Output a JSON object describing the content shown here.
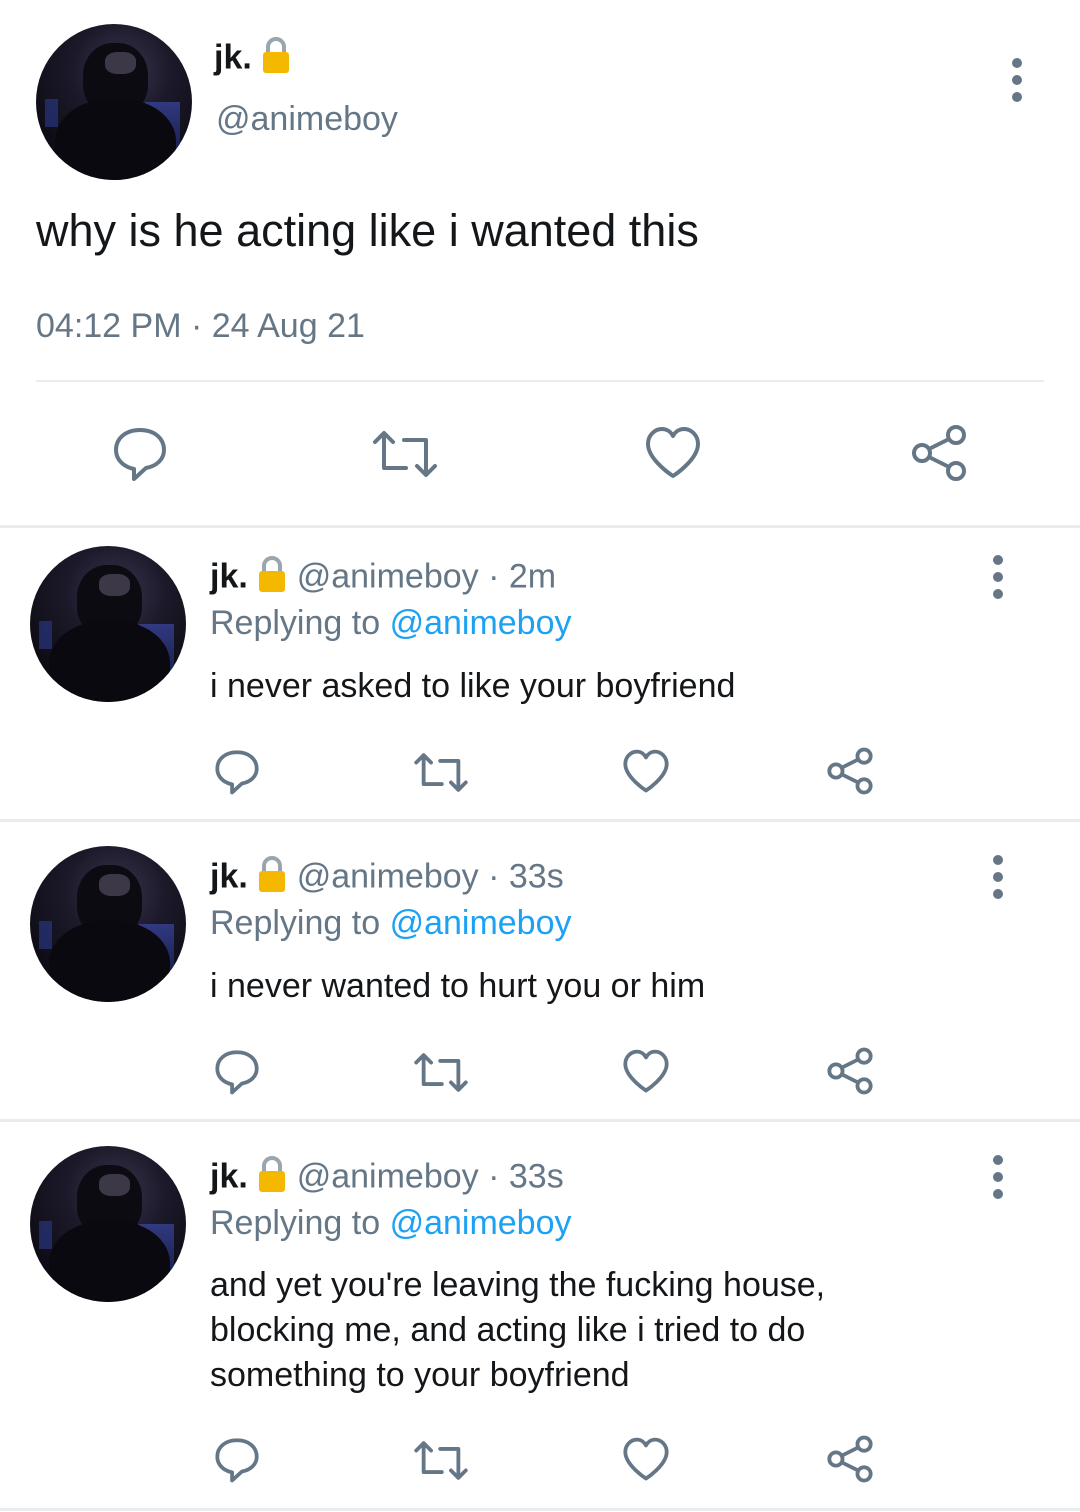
{
  "icons": {
    "more": "vertical-ellipsis-icon",
    "lock": "lock-icon",
    "reply": "reply-bubble-icon",
    "retweet": "retweet-icon",
    "like": "heart-icon",
    "share": "share-icon"
  },
  "colors": {
    "text": "#14171a",
    "muted": "#657786",
    "link": "#1da1f2",
    "lock": "#f5b800",
    "icon": "#657786"
  },
  "main_tweet": {
    "name": "jk.",
    "handle": "@animeboy",
    "text": "why is he acting like i wanted this",
    "timestamp": "04:12 PM · 24 Aug 21"
  },
  "replies": [
    {
      "name": "jk.",
      "handle": "@animeboy",
      "time": "· 2m",
      "replying_label": "Replying to",
      "replying_to": "@animeboy",
      "text": "i never asked to like your boyfriend"
    },
    {
      "name": "jk.",
      "handle": "@animeboy",
      "time": "· 33s",
      "replying_label": "Replying to",
      "replying_to": "@animeboy",
      "text": "i never wanted to hurt you or him"
    },
    {
      "name": "jk.",
      "handle": "@animeboy",
      "time": "· 33s",
      "replying_label": "Replying to",
      "replying_to": "@animeboy",
      "text": "and yet you're leaving the fucking house, blocking me, and acting like i tried to do something to your boyfriend"
    }
  ]
}
